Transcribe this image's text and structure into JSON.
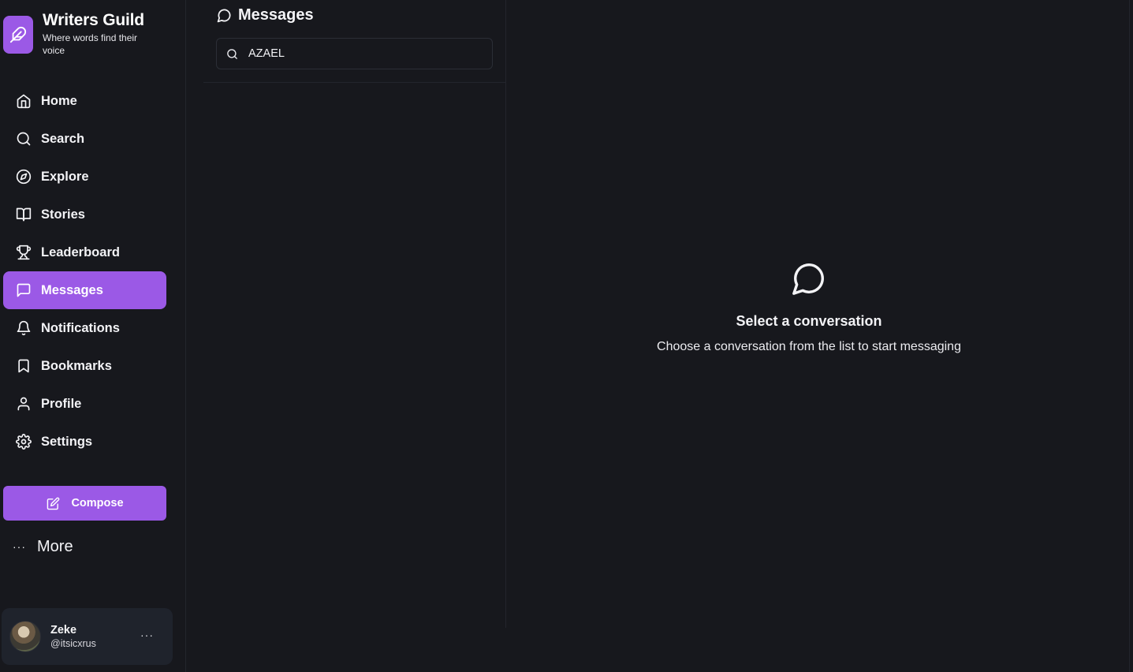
{
  "brand": {
    "title": "Writers Guild",
    "tagline": "Where words find their voice",
    "accent": "#9b59e6"
  },
  "sidebar": {
    "items": [
      {
        "label": "Home",
        "icon": "home-icon",
        "active": false
      },
      {
        "label": "Search",
        "icon": "search-icon",
        "active": false
      },
      {
        "label": "Explore",
        "icon": "compass-icon",
        "active": false
      },
      {
        "label": "Stories",
        "icon": "book-open-icon",
        "active": false
      },
      {
        "label": "Leaderboard",
        "icon": "trophy-icon",
        "active": false
      },
      {
        "label": "Messages",
        "icon": "message-square-icon",
        "active": true
      },
      {
        "label": "Notifications",
        "icon": "bell-icon",
        "active": false
      },
      {
        "label": "Bookmarks",
        "icon": "bookmark-icon",
        "active": false
      },
      {
        "label": "Profile",
        "icon": "user-icon",
        "active": false
      },
      {
        "label": "Settings",
        "icon": "gear-icon",
        "active": false
      }
    ],
    "compose_label": "Compose",
    "more_label": "More"
  },
  "user": {
    "name": "Zeke",
    "handle": "@itsicxrus"
  },
  "messages": {
    "title": "Messages",
    "search_value": "AZAEL"
  },
  "empty_state": {
    "title": "Select a conversation",
    "subtitle": "Choose a conversation from the list to start messaging"
  }
}
